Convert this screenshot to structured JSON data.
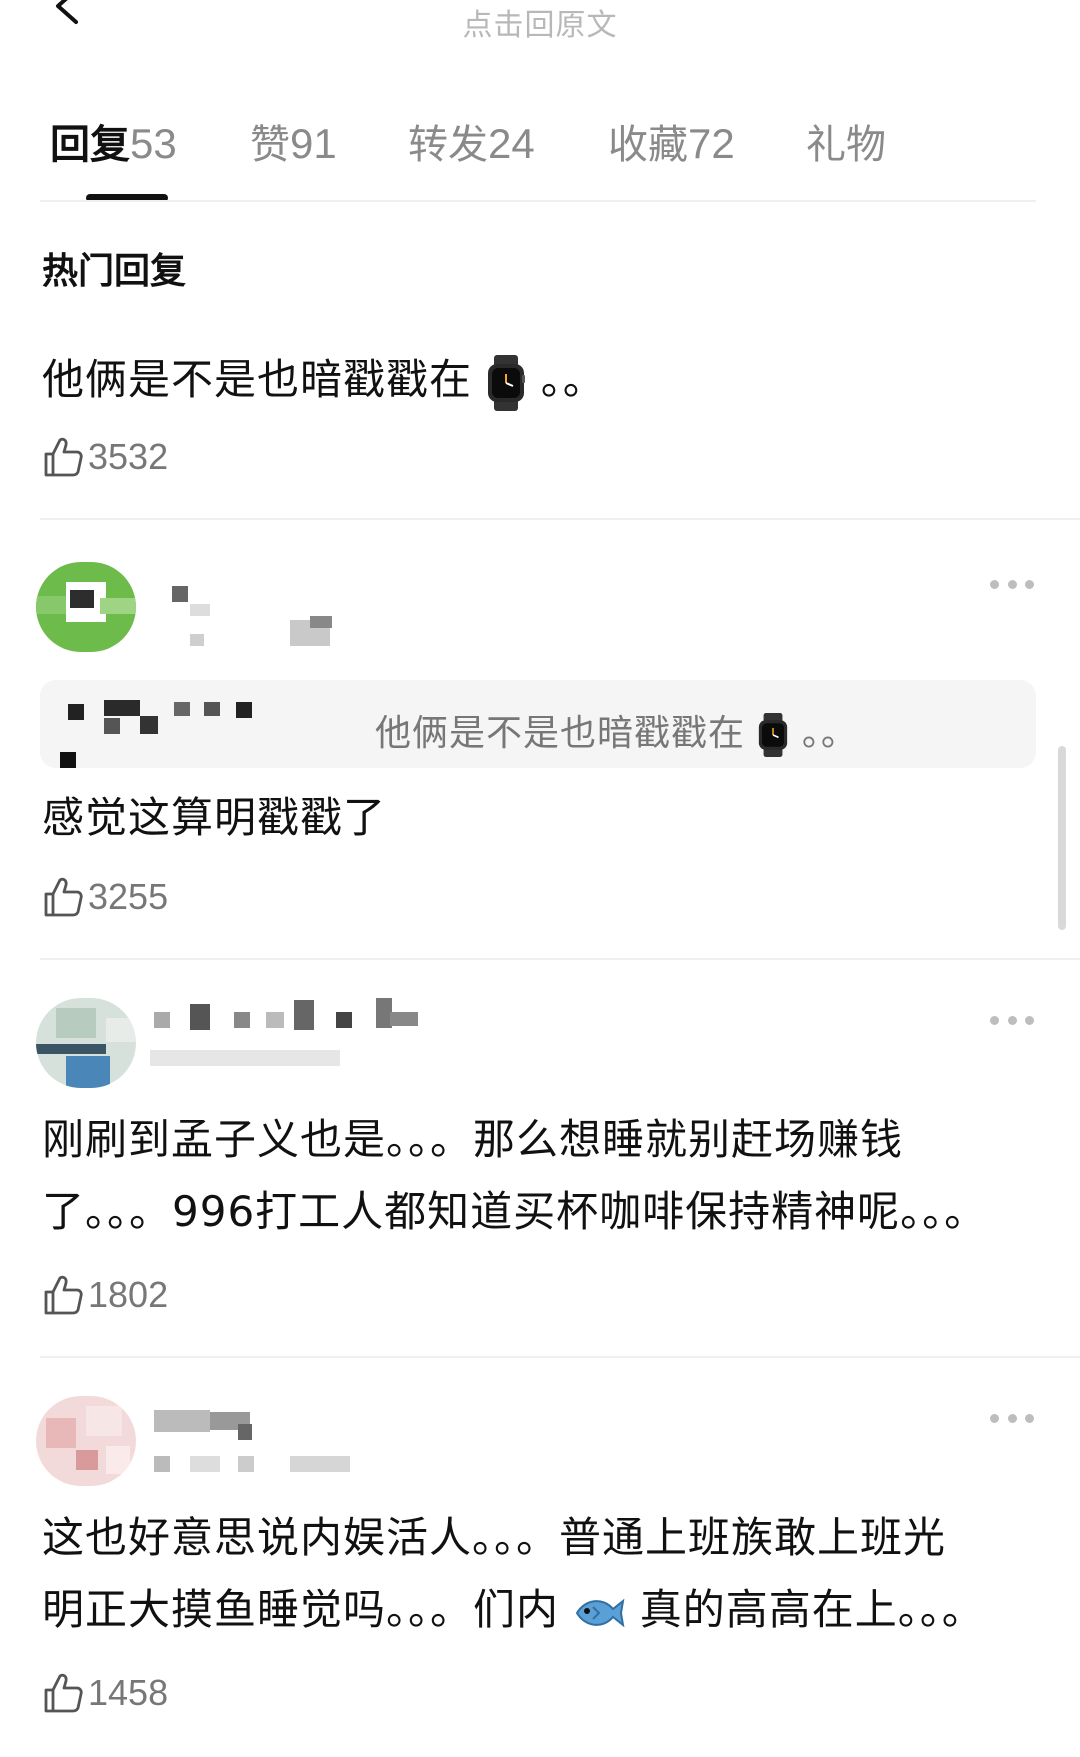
{
  "topbar": {
    "title": "点击回原文"
  },
  "tabs": [
    {
      "label": "回复",
      "count": "53",
      "active": true
    },
    {
      "label": "赞",
      "count": "91"
    },
    {
      "label": "转发",
      "count": "24"
    },
    {
      "label": "收藏",
      "count": "72"
    },
    {
      "label": "礼物",
      "count": ""
    }
  ],
  "section_title": "热门回复",
  "comments": [
    {
      "text_before": "他俩是不是也暗戳戳在",
      "text_after": "。。",
      "icon": "watch-icon",
      "likes": "3532"
    },
    {
      "quote": {
        "text_before": "他俩是不是也暗戳戳在",
        "text_after": "。。",
        "icon": "watch-icon"
      },
      "text": "感觉这算明戳戳了",
      "likes": "3255"
    },
    {
      "lines": [
        "刚刷到孟子义也是。。。那么想睡就别赶场赚钱",
        "了。。。996打工人都知道买杯咖啡保持精神呢。。。"
      ],
      "likes": "1802"
    },
    {
      "line1": "这也好意思说内娱活人。。。普通上班族敢上班光",
      "line2_before": "明正大摸鱼睡觉吗。。。们内",
      "line2_after": "真的高高在上。。。",
      "icon": "fish-icon",
      "likes": "1458"
    }
  ],
  "colors": {
    "text": "#111111",
    "muted": "#777777",
    "divider": "#f0f0f0",
    "quote_bg": "#f5f5f5"
  }
}
